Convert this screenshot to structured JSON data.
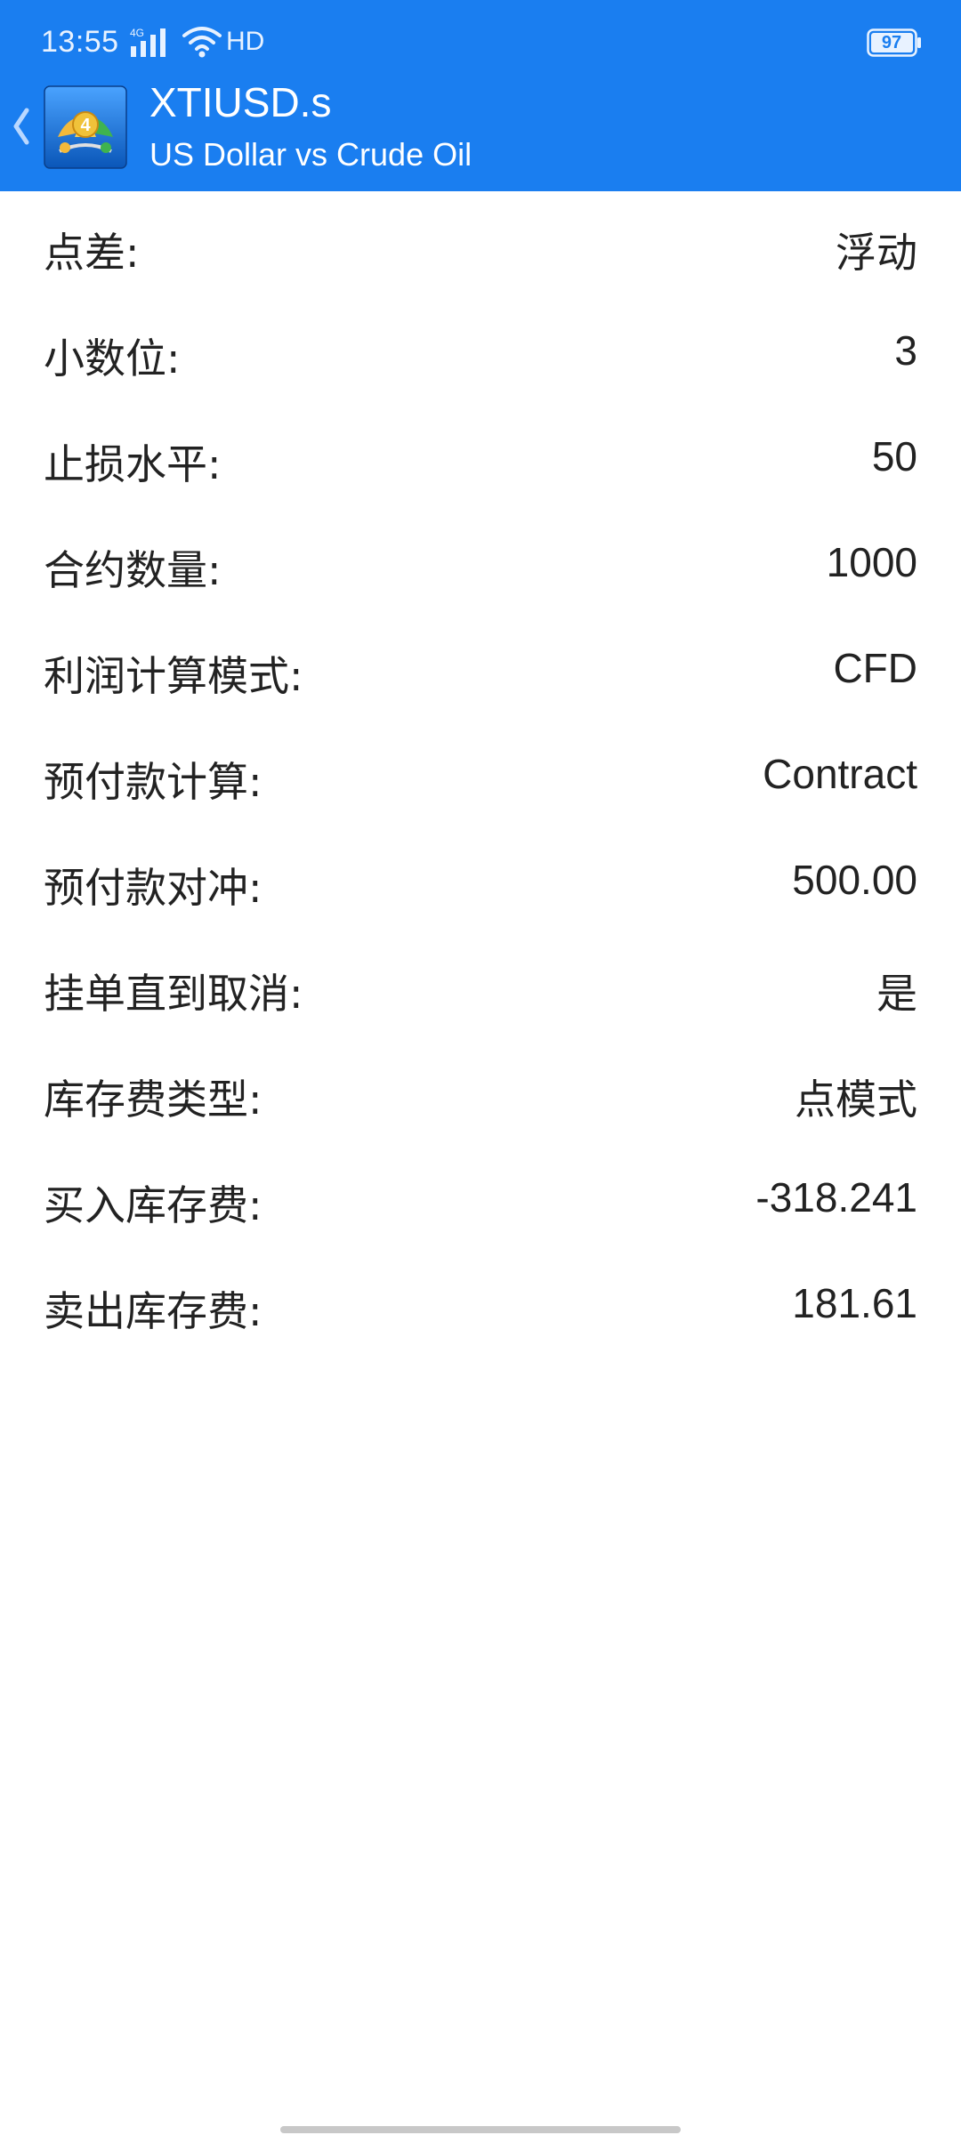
{
  "status_bar": {
    "time": "13:55",
    "network": "4G",
    "hd": "HD",
    "battery": "97"
  },
  "header": {
    "back_icon": "chevron-left-icon",
    "logo_icon": "metatrader-4-icon",
    "title": "XTIUSD.s",
    "subtitle": "US Dollar vs Crude Oil",
    "color": "#1a7ef0"
  },
  "specs": [
    {
      "label": "点差:",
      "value": "浮动"
    },
    {
      "label": "小数位:",
      "value": "3"
    },
    {
      "label": "止损水平:",
      "value": "50"
    },
    {
      "label": "合约数量:",
      "value": "1000"
    },
    {
      "label": "利润计算模式:",
      "value": "CFD"
    },
    {
      "label": "预付款计算:",
      "value": "Contract"
    },
    {
      "label": "预付款对冲:",
      "value": "500.00"
    },
    {
      "label": "挂单直到取消:",
      "value": "是"
    },
    {
      "label": "库存费类型:",
      "value": "点模式"
    },
    {
      "label": "买入库存费:",
      "value": "-318.241"
    },
    {
      "label": "卖出库存费:",
      "value": "181.61"
    }
  ]
}
